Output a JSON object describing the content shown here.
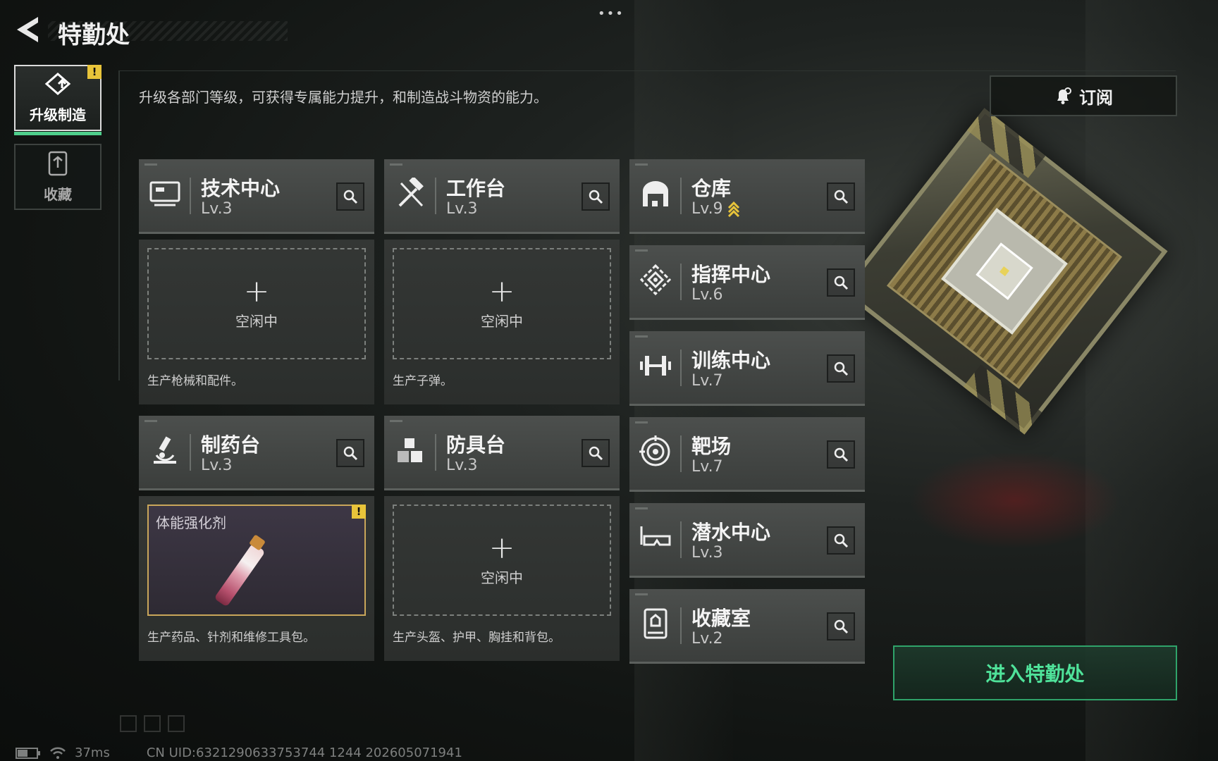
{
  "header": {
    "title": "特勤处",
    "more_label": "•••"
  },
  "sidebar": {
    "tabs": [
      {
        "label": "升级制造",
        "icon": "upgrade-icon",
        "active": true,
        "badge": "!"
      },
      {
        "label": "收藏",
        "icon": "collection-icon",
        "active": false
      }
    ]
  },
  "description": "升级各部门等级，可获得专属能力提升，和制造战斗物资的能力。",
  "subscribe": {
    "label": "订阅",
    "icon": "bell-icon"
  },
  "departments": [
    {
      "name": "技术中心",
      "level": "Lv.3",
      "icon": "computer-icon",
      "slot": {
        "state": "idle",
        "idle_label": "空闲中"
      },
      "caption": "生产枪械和配件。"
    },
    {
      "name": "工作台",
      "level": "Lv.3",
      "icon": "tools-icon",
      "slot": {
        "state": "idle",
        "idle_label": "空闲中"
      },
      "caption": "生产子弹。"
    },
    {
      "name": "制药台",
      "level": "Lv.3",
      "icon": "microscope-icon",
      "slot": {
        "state": "item",
        "item_name": "体能强化剂",
        "badge": "!"
      },
      "caption": "生产药品、针剂和维修工具包。"
    },
    {
      "name": "防具台",
      "level": "Lv.3",
      "icon": "armor-boxes-icon",
      "slot": {
        "state": "idle",
        "idle_label": "空闲中"
      },
      "caption": "生产头盔、护甲、胸挂和背包。"
    }
  ],
  "facilities": [
    {
      "name": "仓库",
      "level": "Lv.9",
      "icon": "warehouse-icon",
      "upgradeable": true
    },
    {
      "name": "指挥中心",
      "level": "Lv.6",
      "icon": "command-icon"
    },
    {
      "name": "训练中心",
      "level": "Lv.7",
      "icon": "dumbbell-icon"
    },
    {
      "name": "靶场",
      "level": "Lv.7",
      "icon": "target-icon"
    },
    {
      "name": "潜水中心",
      "level": "Lv.3",
      "icon": "diving-mask-icon"
    },
    {
      "name": "收藏室",
      "level": "Lv.2",
      "icon": "collection-room-icon"
    }
  ],
  "enter_button": {
    "label": "进入特勤处"
  },
  "status": {
    "ping": "37ms",
    "uid": "CN UID:6321290633753744 1244 202605071941"
  },
  "colors": {
    "accent_green": "#4fe29a",
    "warning_yellow": "#e8c43a",
    "item_border": "#c9a65a"
  }
}
